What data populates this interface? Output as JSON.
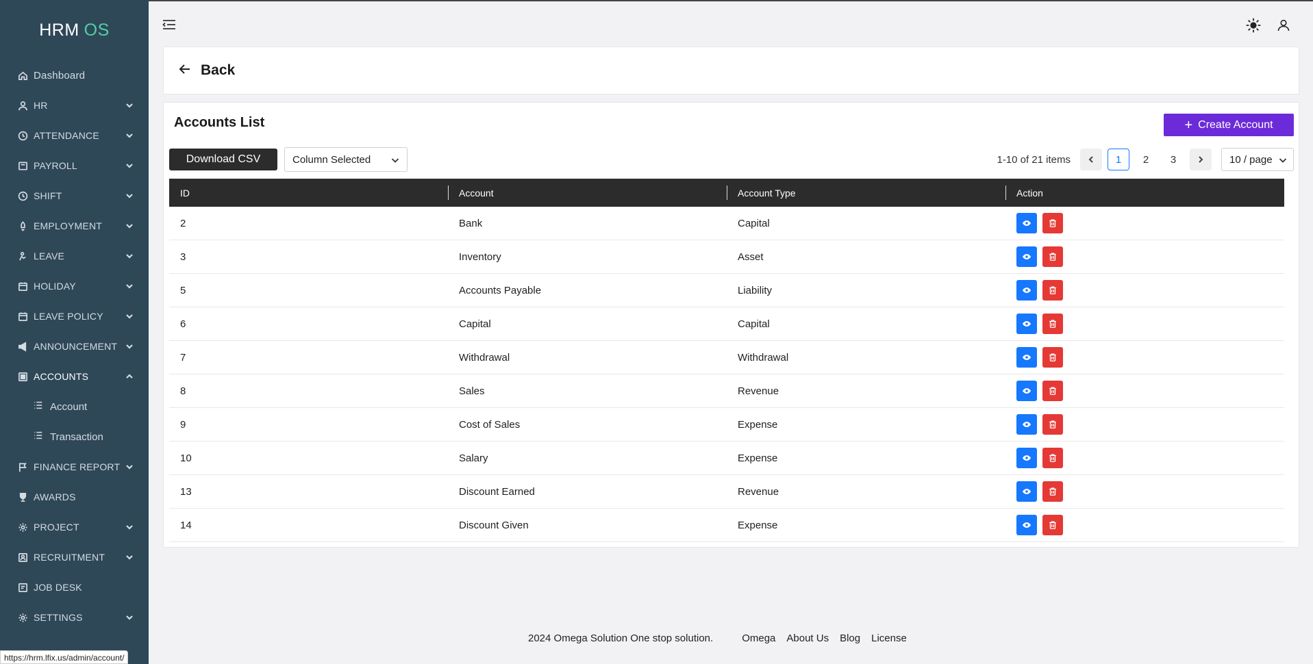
{
  "brand": {
    "name": "HRM",
    "suffix": "OS"
  },
  "sidebar": {
    "items": [
      {
        "label": "Dashboard",
        "icon": "home-icon",
        "expandable": false
      },
      {
        "label": "HR",
        "icon": "user-icon",
        "expandable": true
      },
      {
        "label": "ATTENDANCE",
        "icon": "clock-icon",
        "expandable": true
      },
      {
        "label": "PAYROLL",
        "icon": "wallet-icon",
        "expandable": true
      },
      {
        "label": "SHIFT",
        "icon": "clock-icon",
        "expandable": true
      },
      {
        "label": "EMPLOYMENT",
        "icon": "rocket-icon",
        "expandable": true
      },
      {
        "label": "LEAVE",
        "icon": "leave-icon",
        "expandable": true
      },
      {
        "label": "HOLIDAY",
        "icon": "calendar-icon",
        "expandable": true
      },
      {
        "label": "LEAVE POLICY",
        "icon": "calendar-icon",
        "expandable": true
      },
      {
        "label": "ANNOUNCEMENT",
        "icon": "megaphone-icon",
        "expandable": true
      },
      {
        "label": "ACCOUNTS",
        "icon": "accounts-icon",
        "expandable": true,
        "open": true
      },
      {
        "label": "FINANCE REPORT",
        "icon": "flag-icon",
        "expandable": true
      },
      {
        "label": "AWARDS",
        "icon": "trophy-icon",
        "expandable": false
      },
      {
        "label": "PROJECT",
        "icon": "gear-icon",
        "expandable": true
      },
      {
        "label": "RECRUITMENT",
        "icon": "recruit-icon",
        "expandable": true
      },
      {
        "label": "JOB DESK",
        "icon": "desk-icon",
        "expandable": false
      },
      {
        "label": "SETTINGS",
        "icon": "gear-icon",
        "expandable": true
      }
    ],
    "accounts_sub": [
      {
        "label": "Account",
        "icon": "list-icon"
      },
      {
        "label": "Transaction",
        "icon": "list-icon"
      }
    ]
  },
  "status_url": "https://hrm.lfix.us/admin/account/",
  "back": {
    "label": "Back"
  },
  "list": {
    "title": "Accounts List",
    "create_label": "Create Account",
    "csv_label": "Download CSV",
    "column_select": "Column Selected",
    "range_text": "1-10 of 21 items",
    "pages": [
      "1",
      "2",
      "3"
    ],
    "current_page": "1",
    "page_size": "10 / page"
  },
  "table": {
    "headers": [
      "ID",
      "Account",
      "Account Type",
      "Action"
    ],
    "rows": [
      {
        "id": "2",
        "account": "Bank",
        "type": "Capital"
      },
      {
        "id": "3",
        "account": "Inventory",
        "type": "Asset"
      },
      {
        "id": "5",
        "account": "Accounts Payable",
        "type": "Liability"
      },
      {
        "id": "6",
        "account": "Capital",
        "type": "Capital"
      },
      {
        "id": "7",
        "account": "Withdrawal",
        "type": "Withdrawal"
      },
      {
        "id": "8",
        "account": "Sales",
        "type": "Revenue"
      },
      {
        "id": "9",
        "account": "Cost of Sales",
        "type": "Expense"
      },
      {
        "id": "10",
        "account": "Salary",
        "type": "Expense"
      },
      {
        "id": "13",
        "account": "Discount Earned",
        "type": "Revenue"
      },
      {
        "id": "14",
        "account": "Discount Given",
        "type": "Expense"
      }
    ]
  },
  "footer": {
    "copyright": "2024 Omega Solution One stop solution.",
    "links": [
      "Omega",
      "About Us",
      "Blog",
      "License"
    ]
  },
  "colors": {
    "sidebar": "#2f4858",
    "accent": "#6c2bd9",
    "brand_os": "#4fd1a5",
    "view": "#1677ff",
    "delete": "#e53935"
  }
}
